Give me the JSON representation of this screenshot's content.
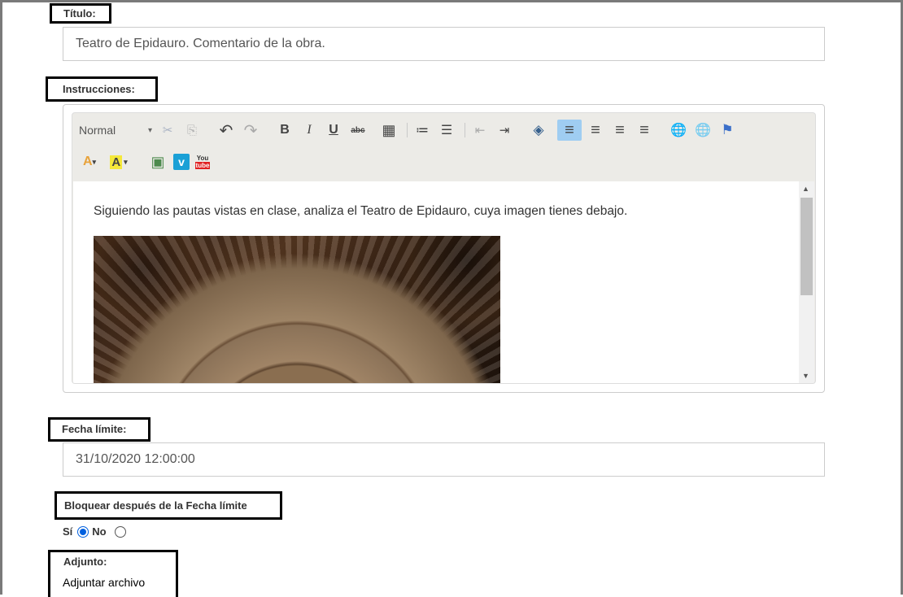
{
  "titulo": {
    "label": "Título:",
    "value": "Teatro de Epidauro. Comentario de la obra."
  },
  "instrucciones": {
    "label": "Instrucciones:",
    "toolbar": {
      "format_select": "Normal",
      "row1_icons": [
        "cut-icon",
        "copy-icon",
        "undo-icon",
        "redo-icon",
        "bold-icon",
        "italic-icon",
        "underline-icon",
        "strikethrough-icon",
        "table-icon",
        "numbered-list-icon",
        "bulleted-list-icon",
        "outdent-icon",
        "indent-icon",
        "source-icon",
        "align-left-icon",
        "align-center-icon",
        "align-right-icon",
        "justify-icon",
        "link-icon",
        "unlink-icon",
        "anchor-icon"
      ],
      "row2_icons": [
        "text-color-icon",
        "background-color-icon",
        "image-icon",
        "vimeo-icon",
        "youtube-icon"
      ],
      "glyphs": {
        "cut": "✂",
        "copy": "⎘",
        "undo": "↶",
        "redo": "↷",
        "bold": "B",
        "italic": "I",
        "underline": "U",
        "strike": "abc",
        "table": "▦",
        "numbered": "≔",
        "bulleted": "☰",
        "outdent": "⇤",
        "indent": "⇥",
        "source": "◈",
        "align_left": "≡",
        "align_center": "≡",
        "align_right": "≡",
        "justify": "≡",
        "link": "🌐",
        "unlink": "🌐",
        "anchor": "⚑",
        "text_color": "A",
        "bg_color": "A",
        "image": "▣",
        "vimeo": "v",
        "youtube": "You"
      }
    },
    "content_text": "Siguiendo las pautas vistas en clase, analiza el Teatro de Epidauro, cuya imagen tienes debajo."
  },
  "fecha_limite": {
    "label": "Fecha límite:",
    "value": "31/10/2020 12:00:00"
  },
  "bloquear": {
    "label": "Bloquear después de la Fecha límite",
    "option_si": "Sí",
    "option_no": "No",
    "selected": "Sí"
  },
  "adjunto": {
    "label": "Adjunto:",
    "button": "Adjuntar archivo"
  },
  "colors": {
    "accent": "#9fcdf2",
    "radio": "#0060df"
  }
}
